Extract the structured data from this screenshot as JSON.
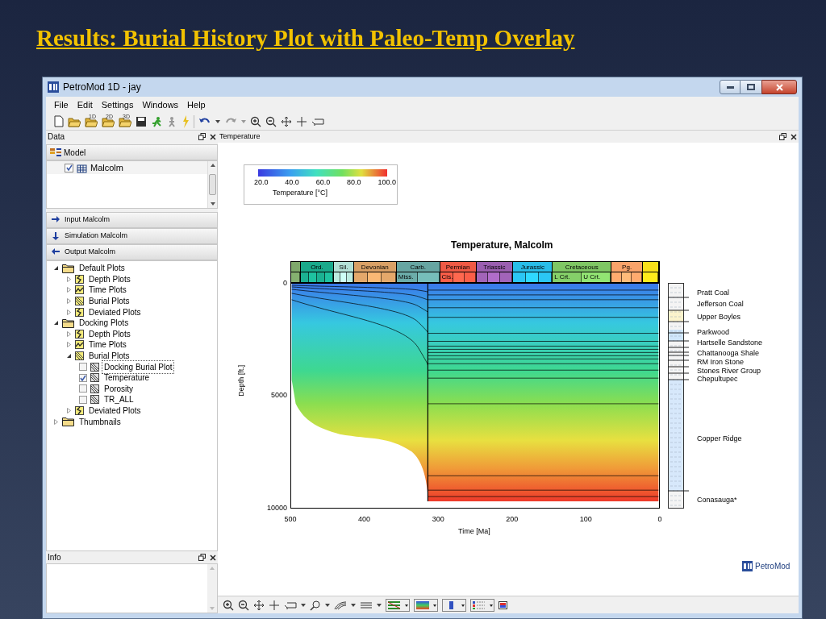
{
  "slide_title": "Results: Burial History Plot with Paleo-Temp Overlay",
  "window": {
    "title": "PetroMod 1D - jay"
  },
  "menu": [
    "File",
    "Edit",
    "Settings",
    "Windows",
    "Help"
  ],
  "toolbar_folders": [
    "1D",
    "2D",
    "3D"
  ],
  "data_panel": {
    "title": "Data",
    "model_header": "Model",
    "models": [
      {
        "label": "Malcolm",
        "checked": true
      }
    ],
    "sections": [
      {
        "label": "Input Malcolm",
        "kind": "input"
      },
      {
        "label": "Simulation Malcolm",
        "kind": "simulation"
      },
      {
        "label": "Output Malcolm",
        "kind": "output"
      }
    ],
    "tree": [
      {
        "label": "Default Plots",
        "kind": "folder",
        "expanded": true,
        "children": [
          {
            "label": "Depth Plots",
            "kind": "depth",
            "expanded": false
          },
          {
            "label": "Time Plots",
            "kind": "time",
            "expanded": false
          },
          {
            "label": "Burial Plots",
            "kind": "burial",
            "expanded": false
          },
          {
            "label": "Deviated Plots",
            "kind": "depth",
            "expanded": false
          }
        ]
      },
      {
        "label": "Docking Plots",
        "kind": "folder",
        "expanded": true,
        "children": [
          {
            "label": "Depth Plots",
            "kind": "depth",
            "expanded": false
          },
          {
            "label": "Time Plots",
            "kind": "time",
            "expanded": false
          },
          {
            "label": "Burial Plots",
            "kind": "burial",
            "expanded": true,
            "children": [
              {
                "label": "Docking Burial Plot",
                "kind": "plot",
                "checked": false,
                "selected": true
              },
              {
                "label": "Temperature",
                "kind": "plot",
                "checked": true,
                "selected": false
              },
              {
                "label": "Porosity",
                "kind": "plot",
                "checked": false,
                "selected": false
              },
              {
                "label": "TR_ALL",
                "kind": "plot",
                "checked": false,
                "selected": false
              }
            ]
          },
          {
            "label": "Deviated Plots",
            "kind": "depth",
            "expanded": false
          }
        ]
      },
      {
        "label": "Thumbnails",
        "kind": "folder",
        "expanded": false
      }
    ]
  },
  "info_panel": {
    "title": "Info"
  },
  "document": {
    "title": "Temperature",
    "legend": {
      "ticks": [
        "20.0",
        "40.0",
        "60.0",
        "80.0",
        "100.0"
      ],
      "label": "Temperature [°C]"
    },
    "plot": {
      "title": "Temperature, Malcolm",
      "y_label": "Depth [ft.]",
      "y_ticks": [
        "0",
        "5000",
        "10000"
      ],
      "x_label": "Time [Ma]",
      "x_ticks": [
        "500",
        "400",
        "300",
        "200",
        "100",
        "0"
      ]
    },
    "periods": [
      {
        "color": "#7fa86b"
      },
      {
        "label": "Ord.",
        "color": "#1aa98b"
      },
      {
        "label": "Sil.",
        "color": "#b3e1d6"
      },
      {
        "label": "Devonian",
        "color": "#d9a066"
      },
      {
        "label": "Carb.",
        "color": "#67a5a2",
        "epochs": [
          "Miss."
        ]
      },
      {
        "label": "Permian",
        "color": "#ef5a45",
        "epochs": [
          "Cis."
        ]
      },
      {
        "label": "Triassic",
        "color": "#9a5fb0"
      },
      {
        "label": "Jurassic",
        "color": "#29bde8"
      },
      {
        "label": "Cretaceous",
        "color": "#7fc664",
        "epochs": [
          "L Crt.",
          "U Crt."
        ]
      },
      {
        "label": "Pg.",
        "color": "#f9a36a"
      },
      {
        "color": "#f9e01a"
      }
    ],
    "formations": [
      "Pratt Coal",
      "Jefferson Coal",
      "Upper Boyles",
      "Parkwood",
      "Hartselle Sandstone",
      "Chattanooga Shale",
      "RM Iron Stone",
      "Stones River Group",
      "Chepultupec",
      "Copper Ridge",
      "Conasauga*"
    ],
    "logo": "PetroMod"
  }
}
